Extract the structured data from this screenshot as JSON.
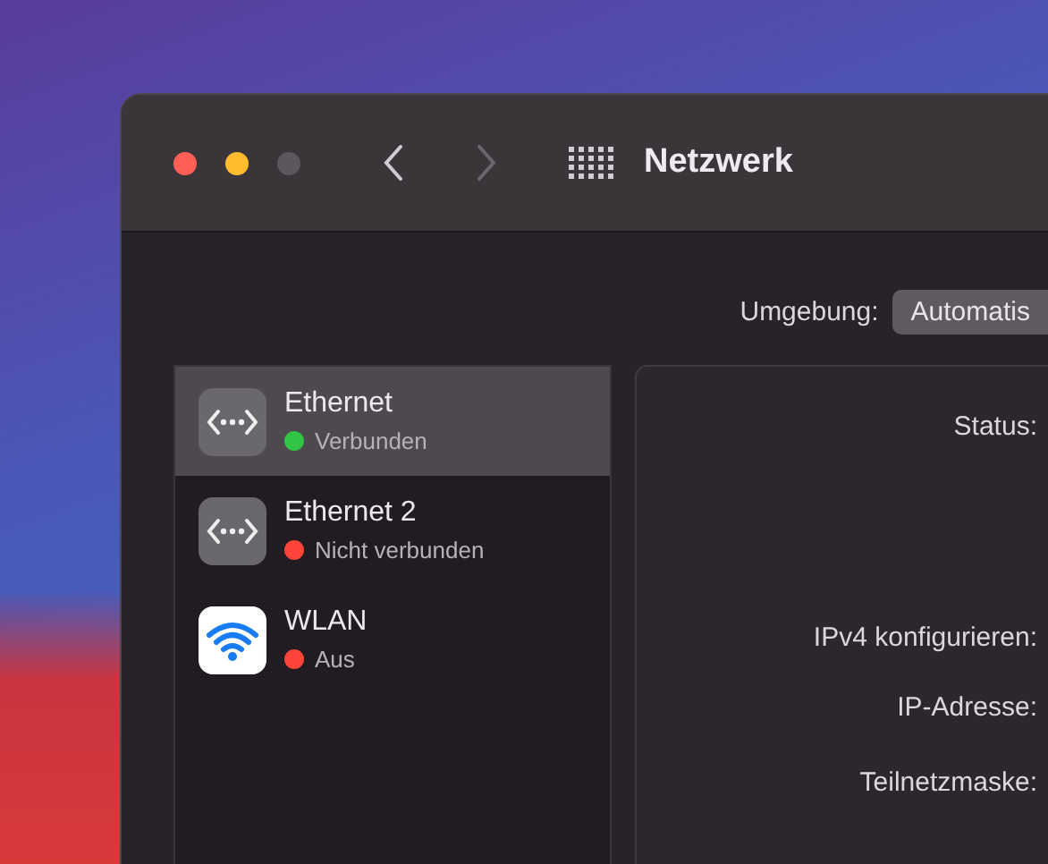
{
  "window": {
    "title": "Netzwerk"
  },
  "location": {
    "label": "Umgebung:",
    "value": "Automatis"
  },
  "services": [
    {
      "kind": "ethernet",
      "name": "Ethernet",
      "status": "Verbunden",
      "color": "#30c544",
      "selected": true
    },
    {
      "kind": "ethernet",
      "name": "Ethernet 2",
      "status": "Nicht verbunden",
      "color": "#ff453a",
      "selected": false
    },
    {
      "kind": "wifi",
      "name": "WLAN",
      "status": "Aus",
      "color": "#ff453a",
      "selected": false
    }
  ],
  "details": {
    "labels": [
      "Status:",
      "IPv4 konfigurieren:",
      "IP-Adresse:",
      "Teilnetzmaske:"
    ]
  }
}
